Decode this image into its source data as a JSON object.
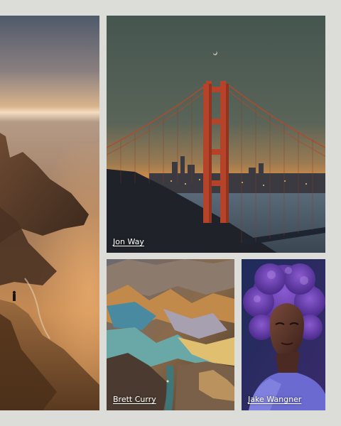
{
  "gallery": {
    "photos": [
      {
        "id": "coast",
        "author": "",
        "alt_icon": "coastal-cliffs-photo"
      },
      {
        "id": "bridge",
        "author": "Jon Way",
        "alt_icon": "golden-gate-bridge-photo"
      },
      {
        "id": "desert",
        "author": "Brett Curry",
        "alt_icon": "painted-hills-photo"
      },
      {
        "id": "portrait",
        "author": "Jake Wangner",
        "alt_icon": "portrait-photo"
      }
    ]
  },
  "colors": {
    "page_background": "#dcdcd8",
    "caption_text": "#ffffff",
    "bridge_orange": "#b5432a"
  }
}
